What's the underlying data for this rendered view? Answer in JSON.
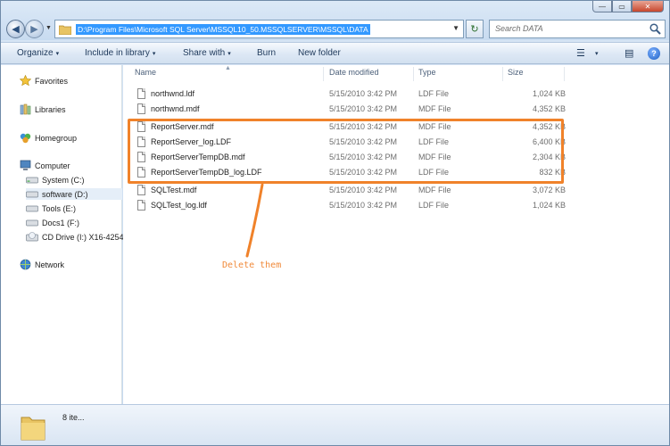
{
  "window": {
    "controls": {
      "minimize": "—",
      "maximize": "▭",
      "close": "✕"
    }
  },
  "navigation": {
    "back_icon": "back-arrow-icon",
    "forward_icon": "forward-arrow-icon",
    "back_glyph": "◀",
    "forward_glyph": "▶",
    "history_dropdown": "▼"
  },
  "address_bar": {
    "path": "D:\\Program Files\\Microsoft SQL Server\\MSSQL10_50.MSSQLSERVER\\MSSQL\\DATA",
    "dropdown": "▼",
    "refresh_glyph": "↻"
  },
  "search": {
    "placeholder": "Search DATA"
  },
  "toolbar": {
    "organize": "Organize",
    "include_in_library": "Include in library",
    "share_with": "Share with",
    "burn": "Burn",
    "new_folder": "New folder",
    "caret": "▾",
    "views_glyph": "☰",
    "pane_glyph": "▤",
    "help_glyph": "?"
  },
  "nav_pane": {
    "favorites": "Favorites",
    "libraries": "Libraries",
    "homegroup": "Homegroup",
    "computer": "Computer",
    "drives": [
      {
        "label": "System (C:)"
      },
      {
        "label": "software (D:)"
      },
      {
        "label": "Tools (E:)"
      },
      {
        "label": "Docs1 (F:)"
      },
      {
        "label": "CD Drive (I:) X16-4254"
      }
    ],
    "network": "Network"
  },
  "columns": {
    "name": "Name",
    "date_modified": "Date modified",
    "type": "Type",
    "size": "Size"
  },
  "files": [
    {
      "name": "northwnd.ldf",
      "date": "5/15/2010 3:42 PM",
      "type": "LDF File",
      "size": "1,024 KB"
    },
    {
      "name": "northwnd.mdf",
      "date": "5/15/2010 3:42 PM",
      "type": "MDF File",
      "size": "4,352 KB"
    },
    {
      "name": "ReportServer.mdf",
      "date": "5/15/2010 3:42 PM",
      "type": "MDF File",
      "size": "4,352 KB"
    },
    {
      "name": "ReportServer_log.LDF",
      "date": "5/15/2010 3:42 PM",
      "type": "LDF File",
      "size": "6,400 KB"
    },
    {
      "name": "ReportServerTempDB.mdf",
      "date": "5/15/2010 3:42 PM",
      "type": "MDF File",
      "size": "2,304 KB"
    },
    {
      "name": "ReportServerTempDB_log.LDF",
      "date": "5/15/2010 3:42 PM",
      "type": "LDF File",
      "size": "832 KB"
    },
    {
      "name": "SQLTest.mdf",
      "date": "5/15/2010 3:42 PM",
      "type": "MDF File",
      "size": "3,072 KB"
    },
    {
      "name": "SQLTest_log.ldf",
      "date": "5/15/2010 3:42 PM",
      "type": "LDF File",
      "size": "1,024 KB"
    }
  ],
  "annotation": {
    "text": "Delete them",
    "color": "#f0822a"
  },
  "status_bar": {
    "item_count": "8 ite..."
  }
}
